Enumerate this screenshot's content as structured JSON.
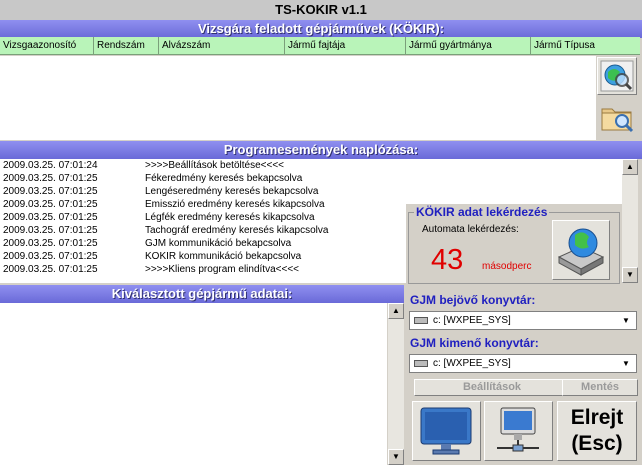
{
  "window": {
    "title": "TS-KOKIR v1.1"
  },
  "vehicles": {
    "header": "Vizsgára feladott gépjárművek (KÖKIR):",
    "columns": [
      "Vizsgaazonosító",
      "Rendszám",
      "Alvázszám",
      "Jármű fajtája",
      "Jármű gyártmánya",
      "Jármű Típusa"
    ]
  },
  "log": {
    "header": "Programesemények naplózása:",
    "entries": [
      {
        "time": "2009.03.25. 07:01:24",
        "message": ">>>>Beállítások betöltése<<<<"
      },
      {
        "time": "2009.03.25. 07:01:25",
        "message": "Fékeredmény keresés bekapcsolva"
      },
      {
        "time": "2009.03.25. 07:01:25",
        "message": "Lengéseredmény keresés bekapcsolva"
      },
      {
        "time": "2009.03.25. 07:01:25",
        "message": "Emisszió eredmény keresés kikapcsolva"
      },
      {
        "time": "2009.03.25. 07:01:25",
        "message": "Légfék eredmény keresés kikapcsolva"
      },
      {
        "time": "2009.03.25. 07:01:25",
        "message": "Tachográf eredmény keresés kikapcsolva"
      },
      {
        "time": "2009.03.25. 07:01:25",
        "message": "GJM kommunikáció bekapcsolva"
      },
      {
        "time": "2009.03.25. 07:01:25",
        "message": "KOKIR kommunikáció bekapcsolva"
      },
      {
        "time": "2009.03.25. 07:01:25",
        "message": ">>>>Kliens program elindítva<<<<"
      }
    ]
  },
  "selected": {
    "header": "Kiválasztott gépjármű adatai:"
  },
  "kokir": {
    "title": "KÖKIR adat lekérdezés",
    "auto_label": "Automata lekérdezés:",
    "countdown": "43",
    "unit": "másodperc"
  },
  "gjm": {
    "incoming_label": "GJM bejövő konyvtár:",
    "incoming_value": "c: [WXPEE_SYS]",
    "outgoing_label": "GJM kimenő konyvtár:",
    "outgoing_value": "c: [WXPEE_SYS]"
  },
  "buttons": {
    "settings": "Beállítások",
    "save": "Mentés",
    "hide_line1": "Elrejt",
    "hide_line2": "(Esc)"
  },
  "colors": {
    "section_bar": "#7a7ae0",
    "column_header": "#b9f4b9",
    "countdown": "#e00000",
    "groupbox_title": "#2020c0"
  }
}
